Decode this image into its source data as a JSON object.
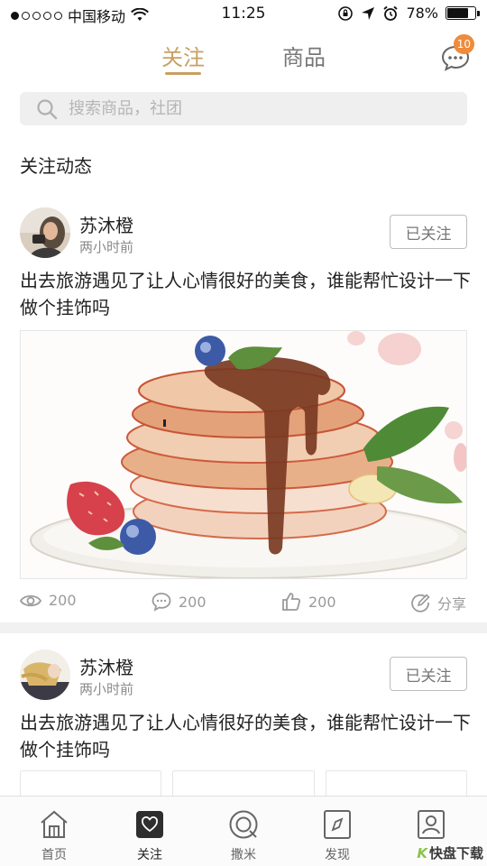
{
  "status_bar": {
    "carrier": "中国移动",
    "time": "11:25",
    "battery": "78%",
    "battery_level": 0.78
  },
  "top_tabs": {
    "tabs": [
      {
        "label": "关注",
        "active": true
      },
      {
        "label": "商品",
        "active": false
      }
    ],
    "message_badge": "10"
  },
  "search": {
    "placeholder": "搜索商品，社团"
  },
  "section": {
    "title": "关注动态"
  },
  "posts": [
    {
      "username": "苏沐橙",
      "time_ago": "两小时前",
      "follow_label": "已关注",
      "text": "出去旅游遇见了让人心情很好的美食，谁能帮忙设计一下做个挂饰吗",
      "stats": {
        "views": "200",
        "comments": "200",
        "likes": "200",
        "share_label": "分享"
      }
    },
    {
      "username": "苏沐橙",
      "time_ago": "两小时前",
      "follow_label": "已关注",
      "text": "出去旅游遇见了让人心情很好的美食，谁能帮忙设计一下做个挂饰吗"
    }
  ],
  "bottom_nav": {
    "items": [
      {
        "label": "首页",
        "icon": "home-icon"
      },
      {
        "label": "关注",
        "icon": "heart-icon",
        "active": true
      },
      {
        "label": "撒米",
        "icon": "rice-icon"
      },
      {
        "label": "发现",
        "icon": "compass-icon"
      },
      {
        "label": "我的",
        "icon": "user-icon"
      }
    ]
  },
  "watermark": {
    "brand": "快盘下载"
  },
  "colors": {
    "accent": "#c8a063",
    "badge": "#ef8b3a",
    "divider": "#f1f1f1"
  }
}
